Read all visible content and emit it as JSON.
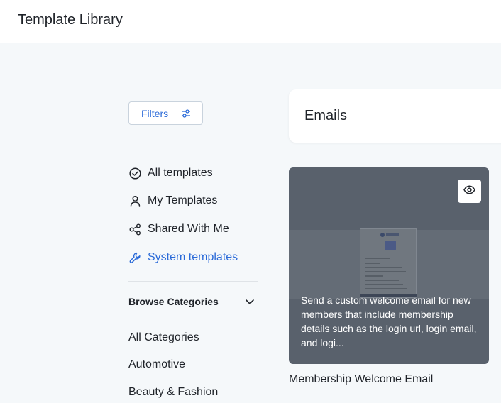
{
  "header": {
    "title": "Template Library"
  },
  "sidebar": {
    "filters_label": "Filters",
    "nav": [
      {
        "label": "All templates",
        "icon": "check-circle-icon",
        "active": false
      },
      {
        "label": "My Templates",
        "icon": "user-icon",
        "active": false
      },
      {
        "label": "Shared With Me",
        "icon": "share-icon",
        "active": false
      },
      {
        "label": "System templates",
        "icon": "wrench-icon",
        "active": true
      }
    ],
    "browse_categories_label": "Browse Categories",
    "categories": [
      "All Categories",
      "Automotive",
      "Beauty & Fashion"
    ]
  },
  "main": {
    "section_title": "Emails",
    "template": {
      "description": "Send a custom welcome email for new members that include membership details such as the login url, login email, and logi...",
      "name": "Membership Welcome Email"
    }
  },
  "colors": {
    "accent": "#2a6ad8",
    "background": "#f5f8fa",
    "card_overlay": "#59616c"
  }
}
